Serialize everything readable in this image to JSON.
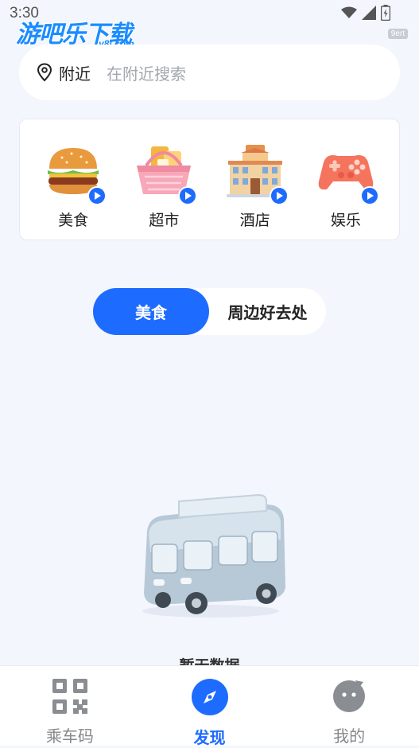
{
  "status_bar": {
    "time": "3:30",
    "watermark": "游吧乐下载",
    "watermark_sub": "y8l.com",
    "badge": "9ert"
  },
  "search": {
    "location": "附近",
    "placeholder": "在附近搜索"
  },
  "categories": [
    {
      "label": "美食",
      "icon": "burger-icon"
    },
    {
      "label": "超市",
      "icon": "shopping-basket-icon"
    },
    {
      "label": "酒店",
      "icon": "hotel-icon"
    },
    {
      "label": "娱乐",
      "icon": "gamepad-icon"
    }
  ],
  "tabs": {
    "active": "美食",
    "inactive": "周边好去处"
  },
  "empty_state": {
    "text": "暂无数据"
  },
  "bottom_nav": [
    {
      "label": "乘车码",
      "icon": "qr-code-icon",
      "active": false
    },
    {
      "label": "发现",
      "icon": "compass-icon",
      "active": true
    },
    {
      "label": "我的",
      "icon": "profile-icon",
      "active": false
    }
  ],
  "colors": {
    "accent": "#1e6bff",
    "background": "#f3f6fd"
  }
}
